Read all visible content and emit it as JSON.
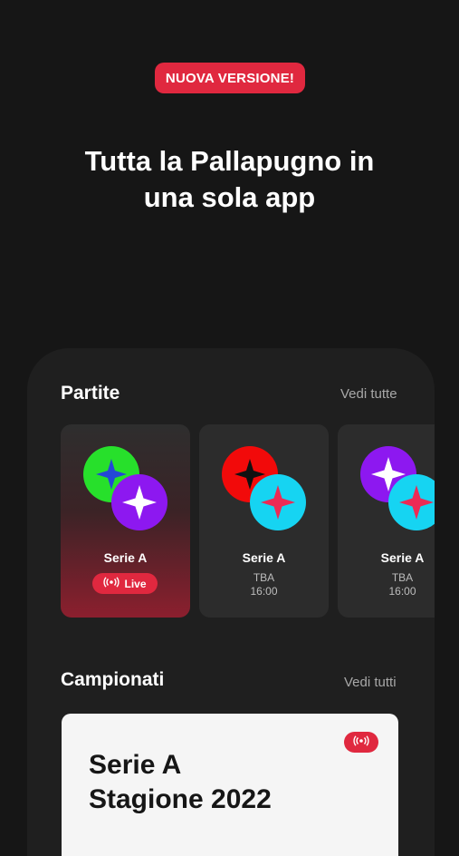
{
  "header": {
    "badge": "NUOVA VERSIONE!",
    "headline_line1": "Tutta la Pallapugno in",
    "headline_line2": "una sola app"
  },
  "partite": {
    "title": "Partite",
    "see_all": "Vedi tutte",
    "cards": [
      {
        "league": "Serie A",
        "status": "Live",
        "teams": [
          "green-team-logo",
          "purple-team-logo"
        ]
      },
      {
        "league": "Serie A",
        "date": "TBA",
        "time": "16:00",
        "teams": [
          "red-team-logo",
          "cyan-team-logo"
        ]
      },
      {
        "league": "Serie A",
        "date": "TBA",
        "time": "16:00",
        "teams": [
          "purple-team-logo",
          "cyan-team-logo"
        ]
      }
    ]
  },
  "campionati": {
    "title": "Campionati",
    "see_all": "Vedi tutti",
    "card": {
      "title_line1": "Serie A",
      "title_line2": "Stagione 2022",
      "icon": "live-broadcast-icon"
    }
  },
  "colors": {
    "background": "#161616",
    "accent": "#e0283f",
    "panel": "#1f1f1f",
    "card": "#2c2c2c"
  }
}
